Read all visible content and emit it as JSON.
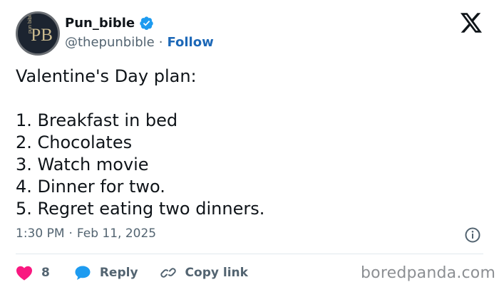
{
  "header": {
    "avatar_text": "PB",
    "avatar_side_text": "pun bible",
    "display_name": "Pun_bible",
    "handle": "@thepunbible",
    "separator": "·",
    "follow_label": "Follow"
  },
  "tweet": {
    "intro": "Valentine's Day plan:",
    "items": [
      "1. Breakfast in bed",
      "2. Chocolates",
      "3. Watch movie",
      "4. Dinner for two.",
      "5. Regret eating two dinners."
    ],
    "time": "1:30 PM",
    "date_sep": "·",
    "date": "Feb 11, 2025"
  },
  "actions": {
    "like_count": "8",
    "reply_label": "Reply",
    "copy_label": "Copy link"
  },
  "watermark": "boredpanda.com",
  "colors": {
    "verified": "#1d9bf0",
    "follow": "#1d68b7",
    "like": "#f91880",
    "reply": "#1d9bf0",
    "muted": "#536471"
  }
}
